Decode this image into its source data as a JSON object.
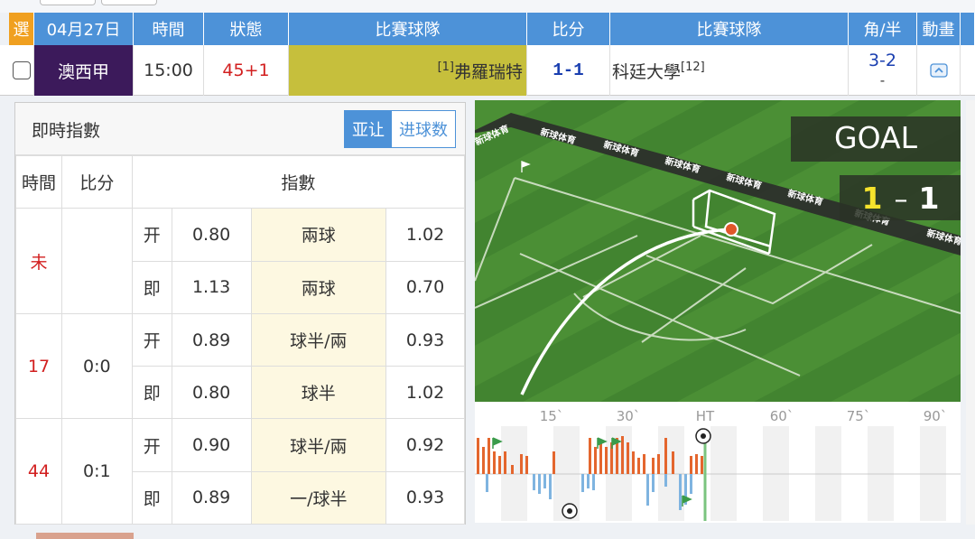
{
  "header": {
    "select": "選",
    "date": "04月27日",
    "time": "時間",
    "status": "狀態",
    "home_team": "比賽球隊",
    "score": "比分",
    "away_team": "比賽球隊",
    "corner_half": "角/半",
    "animation": "動畫"
  },
  "match": {
    "league": "澳西甲",
    "time": "15:00",
    "status": "45+1",
    "home_rank": "[1]",
    "home": "弗羅瑞特",
    "score": "1-1",
    "away": "科廷大學",
    "away_rank": "[12]",
    "corner": "3-2",
    "half": "-"
  },
  "odds_panel": {
    "title": "即時指數",
    "tabs": [
      "亚让",
      "进球数"
    ],
    "active_tab": 0,
    "columns": {
      "time": "時間",
      "score": "比分",
      "index": "指數"
    },
    "groups": [
      {
        "time": "未",
        "score": "",
        "rows": [
          {
            "kind": "开",
            "home": "0.80",
            "line": "兩球",
            "away": "1.02"
          },
          {
            "kind": "即",
            "home": "1.13",
            "line": "兩球",
            "away": "0.70"
          }
        ]
      },
      {
        "time": "17",
        "score": "0:0",
        "rows": [
          {
            "kind": "开",
            "home": "0.89",
            "line": "球半/兩",
            "away": "0.93"
          },
          {
            "kind": "即",
            "home": "0.80",
            "line": "球半",
            "away": "1.02"
          }
        ]
      },
      {
        "time": "44",
        "score": "0:1",
        "rows": [
          {
            "kind": "开",
            "home": "0.90",
            "line": "球半/兩",
            "away": "0.92"
          },
          {
            "kind": "即",
            "home": "0.89",
            "line": "一/球半",
            "away": "0.93"
          }
        ]
      }
    ]
  },
  "animation": {
    "event": "GOAL",
    "score_home": "1",
    "score_sep": "–",
    "score_away": "1",
    "ad_text": "新球体育"
  },
  "timeline": {
    "ticks": [
      "15`",
      "30`",
      "HT",
      "60`",
      "75`",
      "90`"
    ],
    "colors": {
      "home": "#e4662e",
      "away": "#7fb4e0",
      "line": "#7bc47f"
    }
  },
  "colors": {
    "header": "#4d92d8",
    "select": "#f0a020",
    "league": "#3c1a5b",
    "home_bg": "#c6bf3c",
    "status": "#d21f1f",
    "score": "#1a3fb0"
  }
}
